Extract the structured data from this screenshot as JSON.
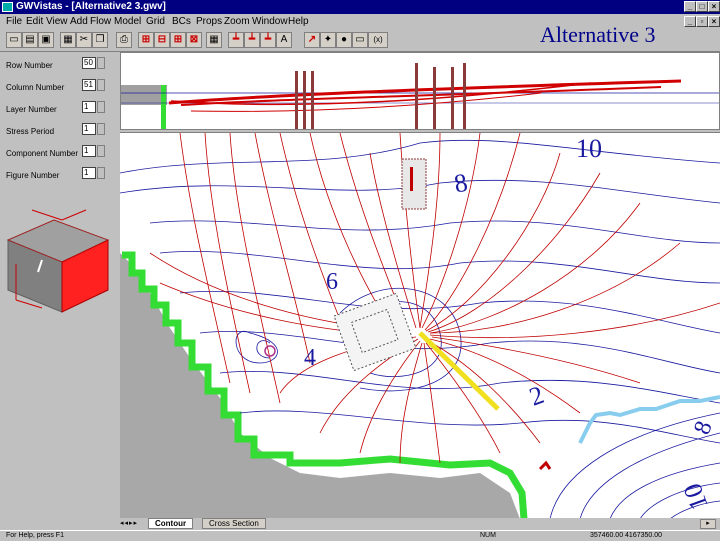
{
  "window": {
    "title": "GWVistas - [Alternative2 3.gwv]"
  },
  "overlay_title": "Alternative 3",
  "menus": [
    "File",
    "Edit",
    "View",
    "Add",
    "Flow",
    "Model",
    "Grid",
    "BCs",
    "Props",
    "Zoom",
    "Window",
    "Help"
  ],
  "toolbar": {
    "buttons": [
      {
        "name": "new-file-icon",
        "glyph": "▭"
      },
      {
        "name": "open-folder-icon",
        "glyph": "▤"
      },
      {
        "name": "save-icon",
        "glyph": "▣"
      },
      {
        "name": "print-icon",
        "glyph": "▦"
      },
      {
        "name": "cut-icon",
        "glyph": "✂"
      },
      {
        "name": "copy-icon",
        "glyph": "❐"
      },
      {
        "name": "paste-icon",
        "glyph": "▥"
      },
      {
        "name": "print-preview-icon",
        "glyph": "⎙"
      },
      {
        "name": "grid-select-icon",
        "glyph": "⊞"
      },
      {
        "name": "grid-row-icon",
        "glyph": "⊟"
      },
      {
        "name": "grid-col-icon",
        "glyph": "⊞"
      },
      {
        "name": "grid-cell-icon",
        "glyph": "⊠"
      },
      {
        "name": "grid-layer-icon",
        "glyph": "▦"
      },
      {
        "name": "bc-well-icon",
        "glyph": "┷"
      },
      {
        "name": "bc-river-icon",
        "glyph": "┷"
      },
      {
        "name": "bc-drain-icon",
        "glyph": "┷"
      },
      {
        "name": "bc-ghb-icon",
        "glyph": "┷"
      },
      {
        "name": "annotate-icon",
        "glyph": "A"
      },
      {
        "name": "pathline-icon",
        "glyph": "↗"
      },
      {
        "name": "particle-icon",
        "glyph": "✦"
      },
      {
        "name": "observation-icon",
        "glyph": "●"
      },
      {
        "name": "zoom-icon",
        "glyph": "▭"
      },
      {
        "name": "formula-icon",
        "glyph": "(x)"
      }
    ]
  },
  "panel": {
    "fields": [
      {
        "label": "Row Number",
        "value": "50"
      },
      {
        "label": "Column Number",
        "value": "51"
      },
      {
        "label": "Layer Number",
        "value": "1"
      },
      {
        "label": "Stress Period",
        "value": "1"
      },
      {
        "label": "Component Number",
        "value": "1"
      },
      {
        "label": "Figure Number",
        "value": "1"
      }
    ]
  },
  "plan_view": {
    "contour_labels": [
      "10",
      "8",
      "6",
      "4",
      "2",
      "8",
      "10"
    ]
  },
  "tabs": [
    {
      "label": "Contour",
      "active": true
    },
    {
      "label": "Cross Section",
      "active": false
    }
  ],
  "statusbar": {
    "help": "For Help, press F1",
    "mode": "NUM",
    "coords": "357460.00   4167350.00"
  },
  "colors": {
    "titlebar": "#000080",
    "pathlines": "#c00000",
    "contours": "#1a1aa0",
    "boundary": "#33dd33",
    "well_line": "#f0e020",
    "stream": "#88ccee"
  }
}
